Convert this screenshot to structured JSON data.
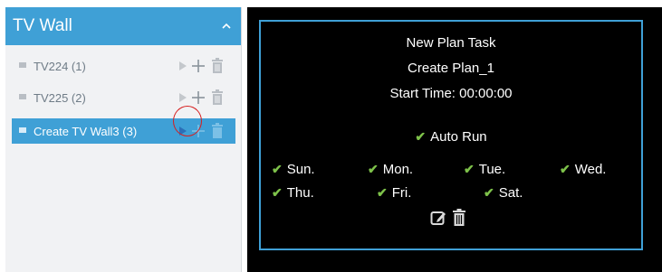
{
  "panel": {
    "title": "TV Wall",
    "items": [
      {
        "label": "TV224 (1)"
      },
      {
        "label": "TV225 (2)"
      },
      {
        "label": "Create TV Wall3 (3)"
      }
    ]
  },
  "plan": {
    "heading": "New Plan Task",
    "name": "Create Plan_1",
    "start_time": "Start Time: 00:00:00",
    "auto_run": "Auto Run",
    "days": [
      "Sun.",
      "Mon.",
      "Tue.",
      "Wed.",
      "Thu.",
      "Fri.",
      "Sat."
    ]
  },
  "colors": {
    "accent": "#3fa0d6",
    "check": "#7ec24a",
    "highlight": "#d61f1f"
  },
  "icons": [
    "chevron-up-icon",
    "play-icon",
    "plus-icon",
    "trash-icon",
    "checkmark-icon",
    "edit-icon"
  ]
}
